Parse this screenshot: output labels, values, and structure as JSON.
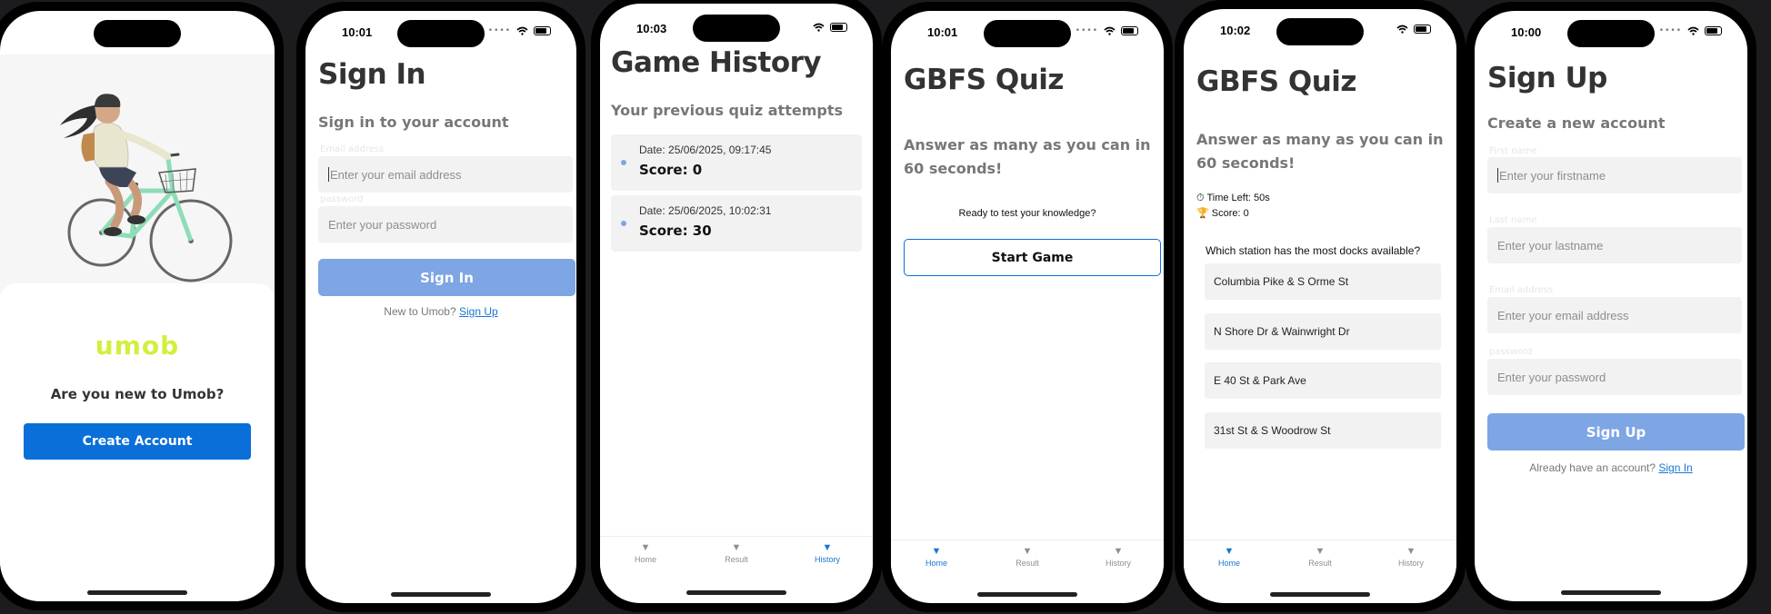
{
  "welcome": {
    "logo_text": "umob",
    "question": "Are you new to Umob?",
    "create_button": "Create Account"
  },
  "signin": {
    "time": "10:01",
    "title": "Sign In",
    "subtitle": "Sign in to your account",
    "email_label": "Email address",
    "email_placeholder": "Enter your email address",
    "password_label": "password",
    "password_placeholder": "Enter your password",
    "button": "Sign In",
    "prompt": "New to Umob?",
    "link": "Sign Up"
  },
  "history": {
    "time": "10:03",
    "title": "Game History",
    "subtitle": "Your previous quiz attempts",
    "items": [
      {
        "date": "Date: 25/06/2025, 09:17:45",
        "score": "Score: 0"
      },
      {
        "date": "Date: 25/06/2025, 10:02:31",
        "score": "Score: 30"
      }
    ],
    "tabs": [
      "Home",
      "Result",
      "History"
    ]
  },
  "quiz_start": {
    "time": "10:01",
    "title": "GBFS Quiz",
    "subtitle": "Answer as many as you can in 60 seconds!",
    "ready_text": "Ready to test your knowledge?",
    "start_button": "Start Game",
    "tabs": [
      "Home",
      "Result",
      "History"
    ]
  },
  "quiz_play": {
    "time": "10:02",
    "title": "GBFS Quiz",
    "subtitle": "Answer as many as you can in 60 seconds!",
    "time_left": "Time Left: 50s",
    "score": "Score: 0",
    "question": "Which station has the most docks available?",
    "options": [
      "Columbia Pike & S Orme St",
      "N Shore Dr & Wainwright Dr",
      "E 40 St & Park Ave",
      "31st St & S Woodrow St"
    ],
    "tabs": [
      "Home",
      "Result",
      "History"
    ]
  },
  "signup": {
    "time": "10:00",
    "title": "Sign Up",
    "subtitle": "Create a new account",
    "firstname_label": "First name",
    "firstname_placeholder": "Enter your firstname",
    "lastname_label": "Last name",
    "lastname_placeholder": "Enter your lastname",
    "email_label": "Email address",
    "email_placeholder": "Enter your email address",
    "password_label": "password",
    "password_placeholder": "Enter your password",
    "button": "Sign Up",
    "prompt": "Already have an account?",
    "link": "Sign In"
  },
  "colors": {
    "primary_blue": "#0a6fd8",
    "button_disabled_blue": "#7ea5e4",
    "link_blue": "#1976d2",
    "logo_green": "#d4ee3c",
    "bike_green": "#8fdcb8"
  }
}
